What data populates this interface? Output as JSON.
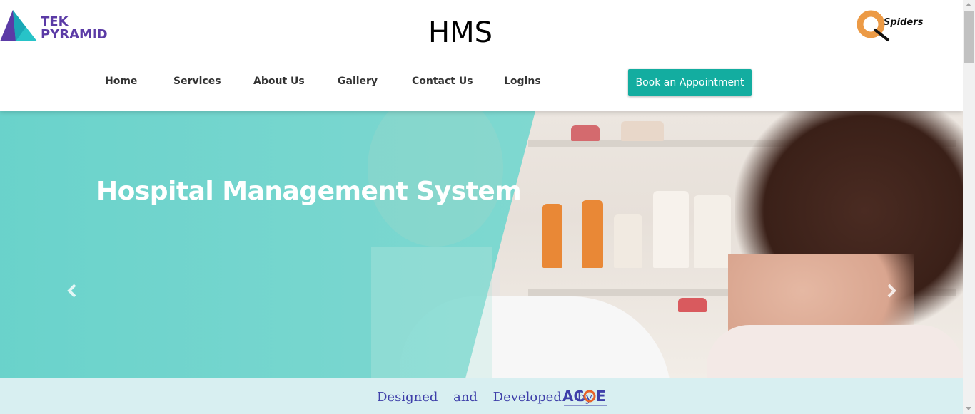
{
  "header": {
    "left_logo": {
      "line1": "TEK",
      "line2": "PYRAMID",
      "icon": "tekpyramid-logo"
    },
    "title": "HMS",
    "right_logo": {
      "text": "Spiders",
      "icon": "qspiders-logo"
    }
  },
  "nav": {
    "items": [
      {
        "label": "Home"
      },
      {
        "label": "Services"
      },
      {
        "label": "About Us"
      },
      {
        "label": "Gallery"
      },
      {
        "label": "Contact Us"
      },
      {
        "label": "Logins"
      }
    ],
    "cta": "Book an Appointment"
  },
  "hero": {
    "title": "Hospital Management System",
    "prev_icon": "chevron-left-icon",
    "next_icon": "chevron-right-icon"
  },
  "footer": {
    "credit": "Designed and Developed by",
    "logo_text": "ACOE",
    "logo_subtext": "Automation Center of Excellence"
  },
  "colors": {
    "accent": "#13ada0",
    "overlay": "#5fd1c9",
    "brand_purple": "#5b3ba6",
    "credit_blue": "#3e3fa9",
    "footer_bg": "#d8eff1"
  }
}
